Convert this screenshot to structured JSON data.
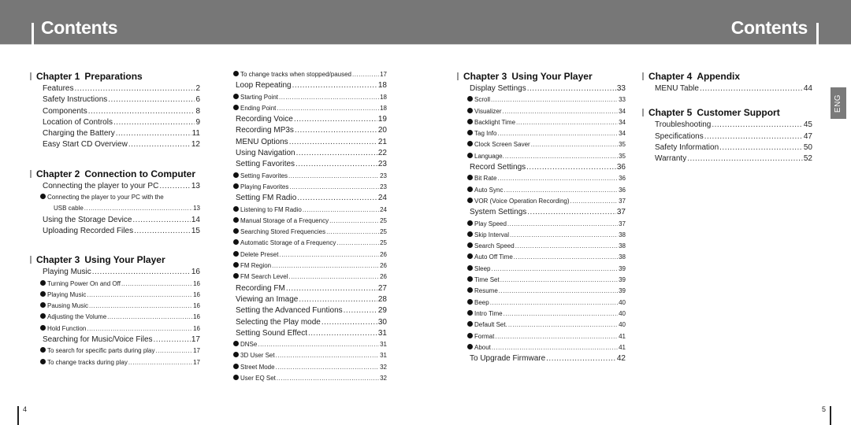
{
  "header": {
    "left_title": "Contents",
    "right_title": "Contents"
  },
  "lang_tab": "ENG",
  "footer": {
    "left_page": "4",
    "right_page": "5"
  },
  "columns": [
    {
      "blocks": [
        {
          "chapter_num": "Chapter 1",
          "chapter_title": "Preparations",
          "entries": [
            {
              "type": "main",
              "label": "Features",
              "page": "2"
            },
            {
              "type": "main",
              "label": "Safety Instructions",
              "page": "6"
            },
            {
              "type": "main",
              "label": "Components",
              "page": "8"
            },
            {
              "type": "main",
              "label": "Location of Controls",
              "page": "9"
            },
            {
              "type": "main",
              "label": "Charging the Battery",
              "page": "11"
            },
            {
              "type": "main",
              "label": "Easy Start CD Overview",
              "page": "12"
            }
          ]
        },
        {
          "chapter_num": "Chapter 2",
          "chapter_title": "Connection to Computer",
          "entries": [
            {
              "type": "main",
              "label": "Connecting the player to your PC",
              "page": "13"
            },
            {
              "type": "sub-nopage",
              "label": "Connecting the player to your PC with the",
              "page": ""
            },
            {
              "type": "cont",
              "label": "USB cable",
              "page": "13"
            },
            {
              "type": "main",
              "label": "Using the Storage Device",
              "page": "14"
            },
            {
              "type": "main",
              "label": "Uploading Recorded Files",
              "page": "15"
            }
          ]
        },
        {
          "chapter_num": "Chapter 3",
          "chapter_title": "Using Your Player",
          "entries": [
            {
              "type": "main",
              "label": "Playing Music",
              "page": "16"
            },
            {
              "type": "sub",
              "label": "Turning Power On and Off",
              "page": "16"
            },
            {
              "type": "sub",
              "label": "Playing Music",
              "page": "16"
            },
            {
              "type": "sub",
              "label": "Pausing Music",
              "page": "16"
            },
            {
              "type": "sub",
              "label": "Adjusting the Volume",
              "page": "16"
            },
            {
              "type": "sub",
              "label": "Hold Function",
              "page": "16"
            },
            {
              "type": "main",
              "label": "Searching for Music/Voice Files",
              "page": "17"
            },
            {
              "type": "sub",
              "label": "To search for specific parts during play",
              "page": "17"
            },
            {
              "type": "sub",
              "label": "To change tracks during play",
              "page": "17"
            }
          ]
        }
      ]
    },
    {
      "blocks": [
        {
          "chapter_num": "",
          "chapter_title": "",
          "entries": [
            {
              "type": "sub",
              "label": "To change tracks when stopped/paused",
              "page": "17"
            },
            {
              "type": "main",
              "label": "Loop Repeating",
              "page": "18"
            },
            {
              "type": "sub",
              "label": "Starting Point",
              "page": "18"
            },
            {
              "type": "sub",
              "label": "Ending Point",
              "page": "18"
            },
            {
              "type": "main",
              "label": "Recording Voice",
              "page": "19"
            },
            {
              "type": "main",
              "label": "Recording MP3s",
              "page": "20"
            },
            {
              "type": "main",
              "label": "MENU Options",
              "page": "21"
            },
            {
              "type": "main",
              "label": "Using Navigation",
              "page": "22"
            },
            {
              "type": "main",
              "label": "Setting Favorites",
              "page": "23"
            },
            {
              "type": "sub",
              "label": "Setting Favorites",
              "page": "23"
            },
            {
              "type": "sub",
              "label": "Playing Favorites",
              "page": "23"
            },
            {
              "type": "main",
              "label": "Setting FM Radio",
              "page": "24"
            },
            {
              "type": "sub",
              "label": "Listening to FM Radio",
              "page": "24"
            },
            {
              "type": "sub",
              "label": "Manual Storage of a Frequency",
              "page": "25"
            },
            {
              "type": "sub",
              "label": "Searching Stored Frequencies",
              "page": "25"
            },
            {
              "type": "sub",
              "label": "Automatic Storage of a Frequency",
              "page": "25"
            },
            {
              "type": "sub",
              "label": "Delete Preset",
              "page": "26"
            },
            {
              "type": "sub",
              "label": "FM Region",
              "page": "26"
            },
            {
              "type": "sub",
              "label": "FM Search Level",
              "page": "26"
            },
            {
              "type": "main",
              "label": "Recording FM",
              "page": "27"
            },
            {
              "type": "main",
              "label": "Viewing an Image",
              "page": "28"
            },
            {
              "type": "main",
              "label": "Setting the Advanced Funtions",
              "page": "29"
            },
            {
              "type": "main",
              "label": "Selecting the Play mode",
              "page": "30"
            },
            {
              "type": "main",
              "label": "Setting Sound Effect",
              "page": "31"
            },
            {
              "type": "sub",
              "label": "DNSe",
              "page": "31"
            },
            {
              "type": "sub",
              "label": "3D User Set",
              "page": "31"
            },
            {
              "type": "sub",
              "label": "Street Mode",
              "page": "32"
            },
            {
              "type": "sub",
              "label": "User EQ Set",
              "page": "32"
            }
          ]
        }
      ]
    },
    {
      "blocks": [
        {
          "chapter_num": "Chapter 3",
          "chapter_title": "Using Your Player",
          "entries": [
            {
              "type": "main",
              "label": "Display Settings",
              "page": "33"
            },
            {
              "type": "sub",
              "label": "Scroll",
              "page": "33"
            },
            {
              "type": "sub",
              "label": "Visualizer",
              "page": "34"
            },
            {
              "type": "sub",
              "label": "Backlight Time",
              "page": "34"
            },
            {
              "type": "sub",
              "label": "Tag Info",
              "page": "34"
            },
            {
              "type": "sub",
              "label": "Clock Screen Saver",
              "page": "35"
            },
            {
              "type": "sub",
              "label": "Language.",
              "page": "35"
            },
            {
              "type": "main",
              "label": "Record Settings",
              "page": "36"
            },
            {
              "type": "sub",
              "label": "Bit Rate",
              "page": "36"
            },
            {
              "type": "sub",
              "label": "Auto Sync",
              "page": "36"
            },
            {
              "type": "sub",
              "label": "VOR (Voice Operation Recording)",
              "page": "37"
            },
            {
              "type": "main",
              "label": "System Settings",
              "page": "37"
            },
            {
              "type": "sub",
              "label": "Play Speed",
              "page": "37"
            },
            {
              "type": "sub",
              "label": "Skip Interval",
              "page": "38"
            },
            {
              "type": "sub",
              "label": "Search Speed",
              "page": "38"
            },
            {
              "type": "sub",
              "label": "Auto Off Time",
              "page": "38"
            },
            {
              "type": "sub",
              "label": "Sleep",
              "page": "39"
            },
            {
              "type": "sub",
              "label": "Time Set",
              "page": "39"
            },
            {
              "type": "sub",
              "label": "Resume",
              "page": "39"
            },
            {
              "type": "sub",
              "label": "Beep",
              "page": "40"
            },
            {
              "type": "sub",
              "label": "Intro Time",
              "page": "40"
            },
            {
              "type": "sub",
              "label": "Default Set.",
              "page": "40"
            },
            {
              "type": "sub",
              "label": "Format",
              "page": "41"
            },
            {
              "type": "sub",
              "label": "About",
              "page": "41"
            },
            {
              "type": "main",
              "label": "To Upgrade Firmware",
              "page": "42"
            }
          ]
        }
      ]
    },
    {
      "blocks": [
        {
          "chapter_num": "Chapter 4",
          "chapter_title": "Appendix",
          "entries": [
            {
              "type": "main",
              "label": "MENU Table",
              "page": "44"
            }
          ]
        },
        {
          "chapter_num": "Chapter 5",
          "chapter_title": "Customer Support",
          "entries": [
            {
              "type": "main",
              "label": "Troubleshooting",
              "page": "45"
            },
            {
              "type": "main",
              "label": "Specifications",
              "page": "47"
            },
            {
              "type": "main",
              "label": "Safety Information",
              "page": "50"
            },
            {
              "type": "main",
              "label": "Warranty",
              "page": "52"
            }
          ]
        }
      ]
    }
  ]
}
